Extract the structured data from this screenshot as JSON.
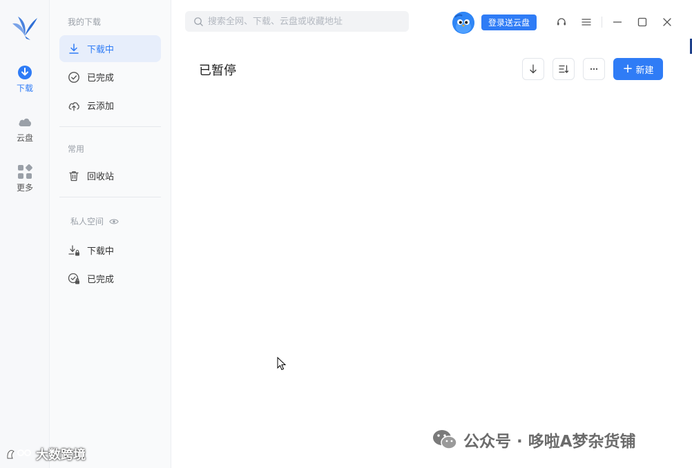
{
  "rail": {
    "items": [
      {
        "label": "下载",
        "icon": "download-circle-icon",
        "active": true
      },
      {
        "label": "云盘",
        "icon": "cloud-icon",
        "active": false
      },
      {
        "label": "更多",
        "icon": "apps-grid-icon",
        "active": false
      }
    ]
  },
  "sidebar": {
    "section_downloads": "我的下载",
    "downloading": "下载中",
    "completed": "已完成",
    "cloud_add": "云添加",
    "section_common": "常用",
    "recycle_bin": "回收站",
    "section_private": "私人空间",
    "private_downloading": "下载中",
    "private_completed": "已完成"
  },
  "header": {
    "search_placeholder": "搜索全网、下载、云盘或收藏地址",
    "login_button": "登录送云盘"
  },
  "main": {
    "title": "已暂停",
    "new_button": "新建"
  },
  "watermarks": {
    "left": "大数跨境",
    "right": "公众号 · 哆啦A梦杂货铺"
  },
  "colors": {
    "accent": "#2f7cf6",
    "active_bg": "#e7eefb"
  }
}
